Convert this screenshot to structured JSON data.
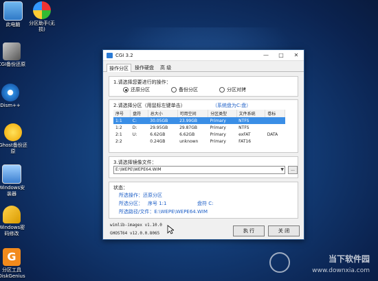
{
  "desktop": {
    "icons": [
      {
        "name": "this-pc",
        "label": "此电脑"
      },
      {
        "name": "partition-assistant",
        "label": "分区助手(无",
        "label2": "损)"
      },
      {
        "name": "cgi-backup-restore",
        "label": "CGI备份还原"
      },
      {
        "name": "dism",
        "label": "Dism++"
      },
      {
        "name": "ghost-backup-restore",
        "label": "Ghost备份还",
        "label2": "原"
      },
      {
        "name": "windows-installer",
        "label": "Windows安",
        "label2": "装器"
      },
      {
        "name": "windows-password",
        "label": "Windows密",
        "label2": "码修改"
      },
      {
        "name": "diskgenius",
        "label": "分区工具",
        "label2": "DiskGenius"
      }
    ]
  },
  "window": {
    "title": "CGI 3.2",
    "tabs": [
      "操作分区",
      "操作硬盘",
      "高 级"
    ],
    "section1": {
      "title": "1.请选择您要进行的操作：",
      "options": [
        "还原分区",
        "备份分区",
        "分区对拷"
      ],
      "selected": "还原分区"
    },
    "section2": {
      "title": "2.请选择分区（用鼠标左键单击）",
      "hint": "（系统盘为C:盘）",
      "columns": [
        "序号",
        "盘符",
        "总大小",
        "可用空间",
        "分区类型",
        "文件系统",
        "卷标"
      ],
      "rows": [
        [
          "1:1",
          "C:",
          "30.05GB",
          "23.99GB",
          "Primary",
          "NTFS",
          ""
        ],
        [
          "1:2",
          "D:",
          "29.95GB",
          "29.87GB",
          "Primary",
          "NTFS",
          ""
        ],
        [
          "2:1",
          "U:",
          "6.62GB",
          "6.62GB",
          "Primary",
          "exFAT",
          "DATA"
        ],
        [
          "2:2",
          "",
          "0.24GB",
          "unknown",
          "Primary",
          "FAT16",
          ""
        ]
      ]
    },
    "section3": {
      "title": "3.请选择镜像文件：",
      "path": "E:\\WEPE\\WEPE64.WIM"
    },
    "status": {
      "title": "状态：",
      "operation": "所选操作：还原分区",
      "partition_label": "所选分区：",
      "partition_id": "序号 1:1",
      "drive": "盘符 C:",
      "path_line": "所选路径/文件：E:\\WEPE\\WEPE64.WIM"
    },
    "versions": [
      "wimlib-imagex v1.10.0",
      "GHOST64 v12.0.0.8065"
    ],
    "buttons": {
      "execute": "执 行",
      "close": "关 闭"
    }
  },
  "watermark": {
    "text": "当下软件园",
    "url": "www.downxia.com"
  }
}
